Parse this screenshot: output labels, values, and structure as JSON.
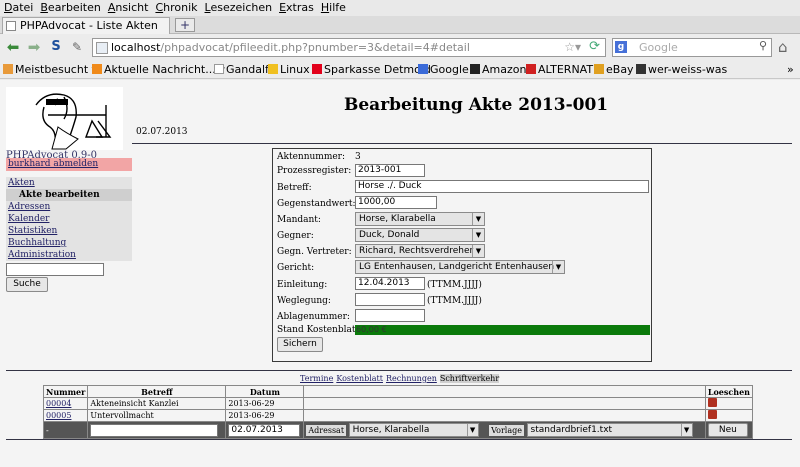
{
  "browser": {
    "menu": [
      "Datei",
      "Bearbeiten",
      "Ansicht",
      "Chronik",
      "Lesezeichen",
      "Extras",
      "Hilfe"
    ],
    "tab_title": "PHPAdvocat - Liste Akten",
    "url_host": "localhost",
    "url_path": "/phpadvocat/pfileedit.php?pnumber=3&detail=4#detail",
    "search_placeholder": "Google",
    "bookmarks": [
      "Meistbesucht ▾",
      "Aktuelle Nachricht... ▾",
      "Gandalf",
      "Linux",
      "Sparkasse Detmold",
      "Google",
      "Amazon",
      "ALTERNATE",
      "eBay",
      "wer-weiss-was"
    ],
    "bookmark_more": "»"
  },
  "header": {
    "title": "Bearbeitung Akte 2013-001",
    "date": "02.07.2013",
    "version": "PHPAdvocat 0.9-0"
  },
  "sidebar": {
    "logout": "burkhard abmelden",
    "items": [
      "Akten",
      "Akte bearbeiten",
      "Adressen",
      "Kalender",
      "Statistiken",
      "Buchhaltung",
      "Administration"
    ],
    "search_button": "Suche"
  },
  "form": {
    "labels": {
      "aktennummer": "Aktennummer:",
      "prozessregister": "Prozessregister:",
      "betreff": "Betreff:",
      "gegenstandwert": "Gegenstandwert:",
      "mandant": "Mandant:",
      "gegner": "Gegner:",
      "vertreter": "Gegn. Vertreter:",
      "gericht": "Gericht:",
      "einleitung": "Einleitung:",
      "weglegung": "Weglegung:",
      "ablagenummer": "Ablagenummer:",
      "kostenblatt": "Stand Kostenblatt:"
    },
    "values": {
      "aktennummer": "3",
      "prozessregister": "2013-001",
      "betreff": "Horse ./. Duck",
      "gegenstandwert": "1000,00",
      "mandant": "Horse, Klarabella",
      "gegner": "Duck, Donald",
      "vertreter": "Richard, Rechtsverdreher",
      "gericht": "LG Entenhausen, Landgericht Entenhausen",
      "einleitung": "12.04.2013",
      "weglegung": "",
      "ablagenummer": "",
      "kostenblatt": "60,00 €"
    },
    "date_hint": "(TTMM.JJJJ)",
    "save_button": "Sichern"
  },
  "subnav": {
    "items": [
      "Termine",
      "Kostenblatt",
      "Rechnungen",
      "Schriftverkehr"
    ]
  },
  "table": {
    "headers": [
      "Nummer",
      "Betreff",
      "Datum",
      "Loeschen"
    ],
    "rows": [
      {
        "nummer": "00004",
        "betreff": "Akteneinsicht Kanzlei",
        "datum": "2013-06-29"
      },
      {
        "nummer": "00005",
        "betreff": "Untervollmacht",
        "datum": "2013-06-29"
      }
    ],
    "new_row": {
      "dash": "-",
      "betreff": "",
      "datum": "02.07.2013",
      "adressat_label": "Adressat",
      "adressat": "Horse, Klarabella",
      "vorlage_label": "Vorlage",
      "vorlage": "standardbrief1.txt",
      "new_button": "Neu"
    }
  }
}
